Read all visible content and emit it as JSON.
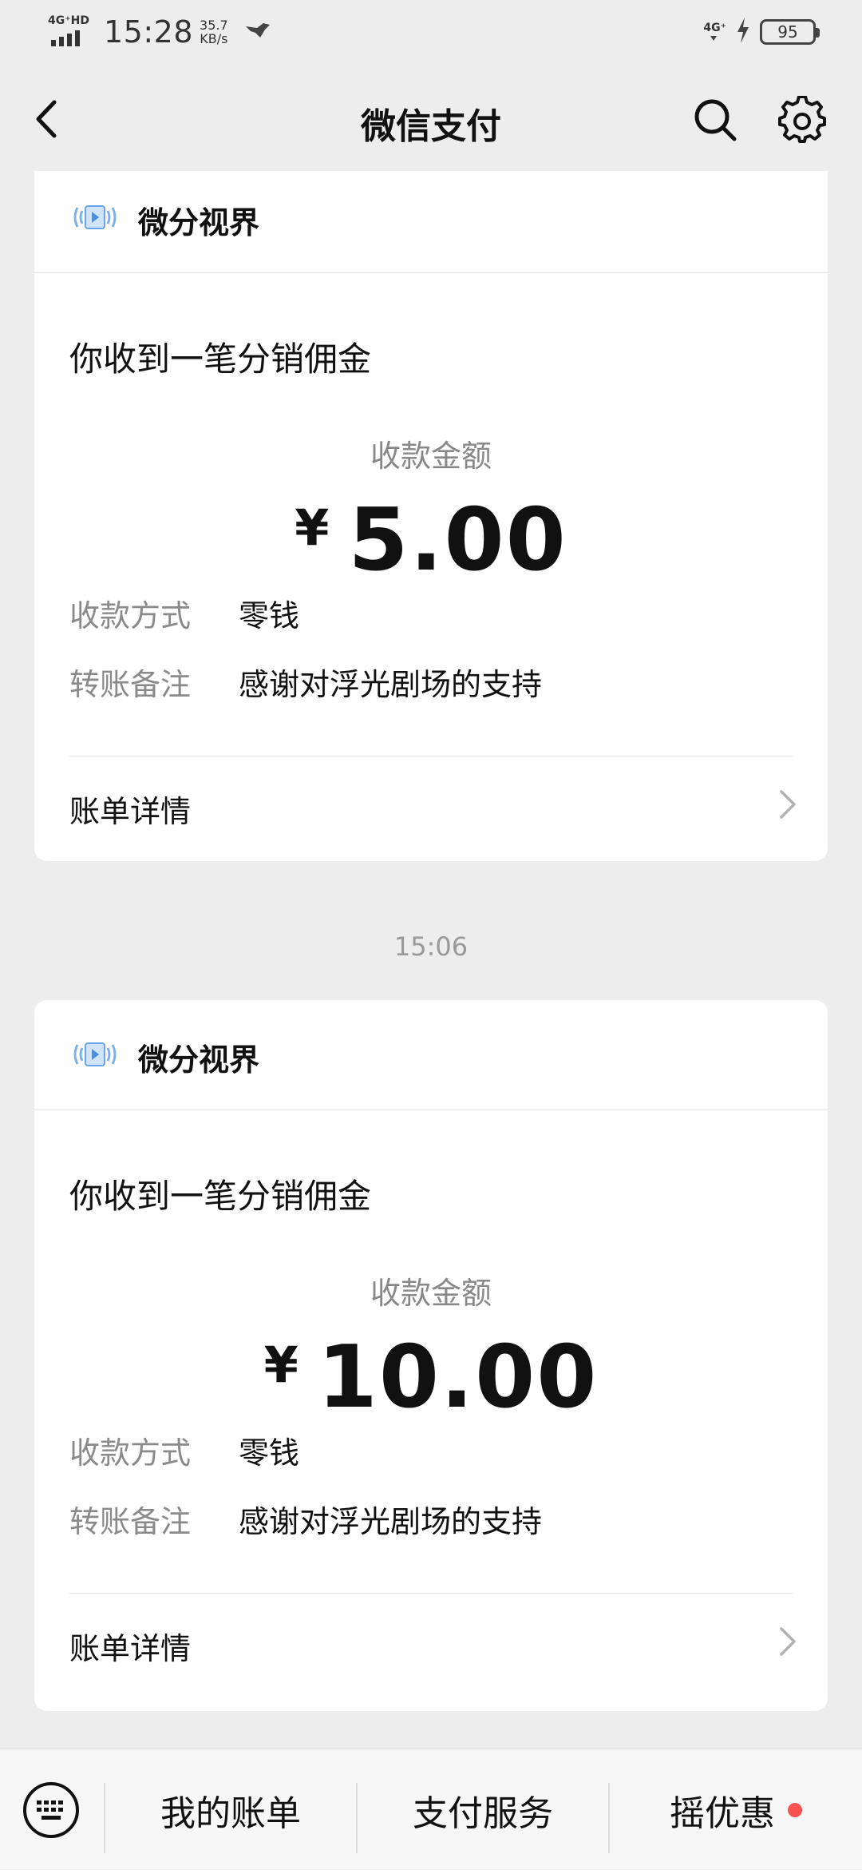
{
  "status_bar": {
    "network_label": "4G⁺HD",
    "time": "15:28",
    "speed_value": "35.7",
    "speed_unit": "KB/s",
    "network_right": "4G⁺",
    "battery": "95"
  },
  "nav": {
    "title": "微信支付",
    "back_icon": "chevron-left-icon",
    "search_icon": "search-icon",
    "settings_icon": "gear-icon"
  },
  "messages": [
    {
      "source_name": "微分视界",
      "title": "你收到一笔分销佣金",
      "amount_label": "收款金额",
      "currency": "¥",
      "amount": "5.00",
      "method_key": "收款方式",
      "method_value": "零钱",
      "note_key": "转账备注",
      "note_value": "感谢对浮光剧场的支持",
      "detail_label": "账单详情"
    },
    {
      "timestamp": "15:06",
      "source_name": "微分视界",
      "title": "你收到一笔分销佣金",
      "amount_label": "收款金额",
      "currency": "¥",
      "amount": "10.00",
      "method_key": "收款方式",
      "method_value": "零钱",
      "note_key": "转账备注",
      "note_value": "感谢对浮光剧场的支持",
      "detail_label": "账单详情"
    }
  ],
  "bottom_bar": {
    "keyboard_icon": "keyboard-icon",
    "tabs": [
      {
        "label": "我的账单"
      },
      {
        "label": "支付服务"
      },
      {
        "label": "摇优惠",
        "badge": true
      }
    ],
    "badge_color": "#fa5151"
  }
}
